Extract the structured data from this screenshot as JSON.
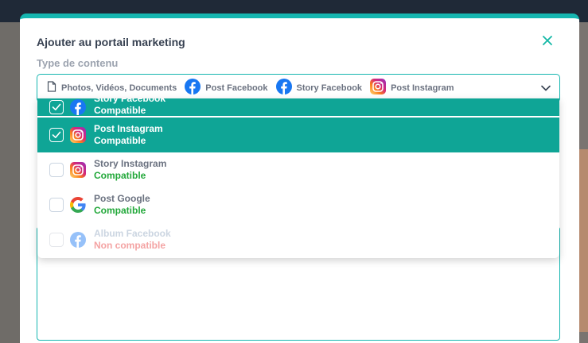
{
  "modal": {
    "title": "Ajouter au portail marketing",
    "close_icon": "close-icon",
    "accent": "#16b6b0"
  },
  "content_type": {
    "label": "Type de contenu",
    "selected_chips": [
      {
        "icon": "document-icon",
        "label": "Photos, Vidéos, Documents"
      },
      {
        "icon": "facebook-icon",
        "label": "Post Facebook"
      },
      {
        "icon": "facebook-icon",
        "label": "Story Facebook"
      },
      {
        "icon": "instagram-icon",
        "label": "Post Instagram"
      }
    ]
  },
  "dropdown": {
    "options": [
      {
        "name": "Story Facebook",
        "status": "Compatible",
        "icon": "facebook-icon",
        "checked": true,
        "enabled": true
      },
      {
        "name": "Post Instagram",
        "status": "Compatible",
        "icon": "instagram-icon",
        "checked": true,
        "enabled": true
      },
      {
        "name": "Story Instagram",
        "status": "Compatible",
        "icon": "instagram-icon",
        "checked": false,
        "enabled": true
      },
      {
        "name": "Post Google",
        "status": "Compatible",
        "icon": "google-icon",
        "checked": false,
        "enabled": true
      },
      {
        "name": "Album Facebook",
        "status": "Non compatible",
        "icon": "facebook-icon",
        "checked": false,
        "enabled": false
      }
    ],
    "selected_color": "#0fa596",
    "compatible_color": "#22a83a",
    "incompatible_color": "#f4a3a3"
  }
}
